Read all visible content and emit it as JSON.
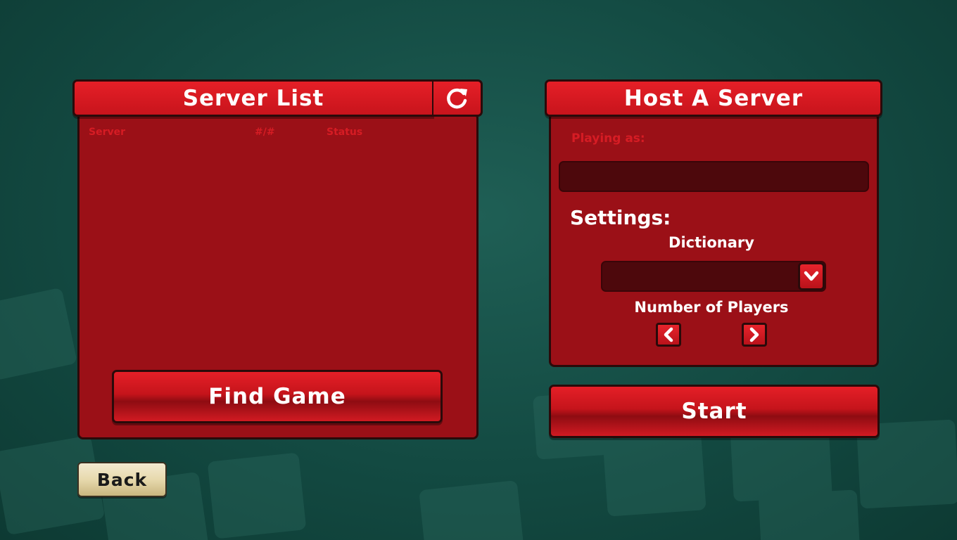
{
  "server_list": {
    "title": "Server List",
    "columns": [
      "Server",
      "#/#",
      "Status"
    ],
    "find_game_label": "Find Game"
  },
  "host": {
    "title": "Host A Server",
    "playing_as_label": "Playing as:",
    "settings_label": "Settings:",
    "dictionary_label": "Dictionary",
    "players_label": "Number of Players",
    "start_label": "Start"
  },
  "back_label": "Back",
  "colors": {
    "panel_red": "#9b1017",
    "header_red": "#e51f27",
    "field_dark": "#4d080c",
    "background_teal": "#134a42"
  },
  "icons": [
    "refresh-icon",
    "chevron-down-icon",
    "chevron-left-icon",
    "chevron-right-icon"
  ]
}
